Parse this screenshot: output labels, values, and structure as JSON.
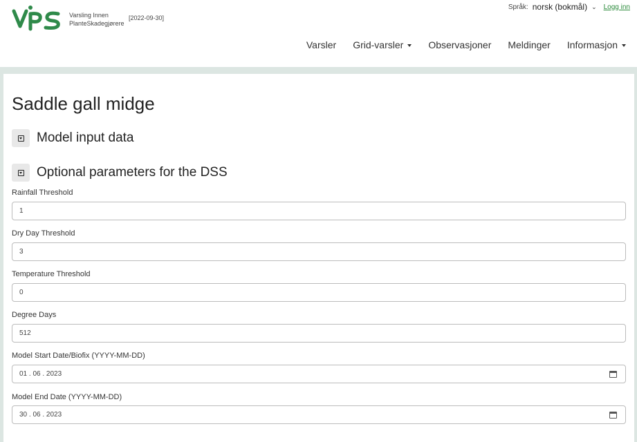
{
  "header": {
    "logo_text": "VIPS",
    "logo_sub_line1": "Varsling Innen",
    "logo_sub_line2": "PlanteSkadegjørere",
    "version_date": "[2022-09-30]",
    "language_label": "Språk:",
    "language_value": "norsk (bokmål)",
    "login_label": "Logg inn",
    "nav": [
      {
        "label": "Varsler",
        "dropdown": false
      },
      {
        "label": "Grid-varsler",
        "dropdown": true
      },
      {
        "label": "Observasjoner",
        "dropdown": false
      },
      {
        "label": "Meldinger",
        "dropdown": false
      },
      {
        "label": "Informasjon",
        "dropdown": true
      }
    ]
  },
  "colors": {
    "brand_green": "#2f8a4a",
    "band_bg": "#dce6e2",
    "link_green": "#2a8a3a"
  },
  "main": {
    "title": "Saddle gall midge",
    "sections": [
      {
        "label": "Model input data"
      },
      {
        "label": "Optional parameters for the DSS"
      }
    ],
    "fields": [
      {
        "label": "Rainfall Threshold",
        "value": "1"
      },
      {
        "label": "Dry Day Threshold",
        "value": "3"
      },
      {
        "label": "Temperature Threshold",
        "value": "0"
      },
      {
        "label": "Degree Days",
        "value": "512"
      },
      {
        "label": "Model Start Date/Biofix (YYYY-MM-DD)",
        "value": "01 . 06 . 2023"
      },
      {
        "label": "Model End Date (YYYY-MM-DD)",
        "value": "30 . 06 . 2023"
      }
    ]
  }
}
